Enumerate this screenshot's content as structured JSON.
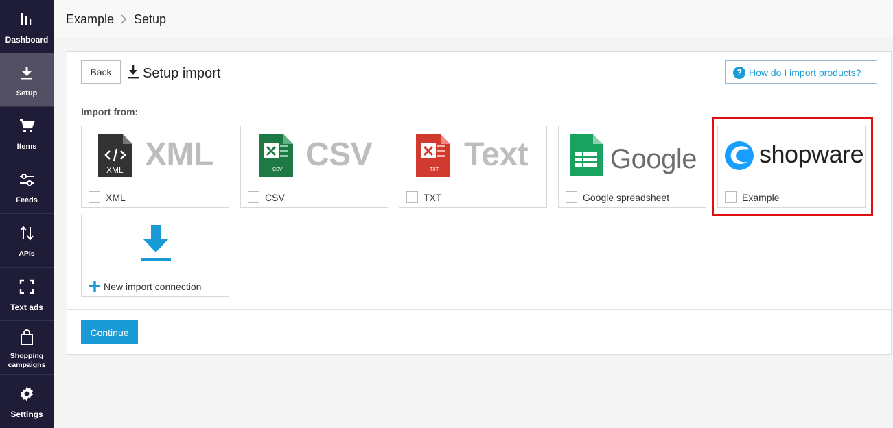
{
  "sidebar": {
    "items": [
      {
        "label": "Dashboard",
        "icon": "bar-chart-icon"
      },
      {
        "label": "Setup",
        "icon": "download-icon"
      },
      {
        "label": "Items",
        "icon": "cart-icon"
      },
      {
        "label": "Feeds",
        "icon": "sliders-icon"
      },
      {
        "label": "APIs",
        "icon": "arrows-updown-icon"
      },
      {
        "label": "Text ads",
        "icon": "frame-icon"
      },
      {
        "label": "Shopping campaigns",
        "icon": "shopping-bag-icon"
      },
      {
        "label": "Settings",
        "icon": "gear-icon"
      }
    ],
    "active_index": 1
  },
  "breadcrumb": {
    "root": "Example",
    "current": "Setup"
  },
  "panel": {
    "back_label": "Back",
    "title": "Setup import",
    "help_label": "How do I import products?",
    "import_from_label": "Import from:",
    "sources": [
      {
        "label": "XML",
        "logo_text": "XML",
        "file_badge": "XML"
      },
      {
        "label": "CSV",
        "logo_text": "CSV",
        "file_badge": "CSV"
      },
      {
        "label": "TXT",
        "logo_text": "Text",
        "file_badge": "TXT"
      },
      {
        "label": "Google spreadsheet",
        "logo_text": "Google"
      },
      {
        "label": "Example",
        "logo_text": "shopware"
      }
    ],
    "new_connection_label": "New import connection",
    "continue_label": "Continue"
  },
  "colors": {
    "sidebar_bg": "#1f1c37",
    "sidebar_active": "#535064",
    "accent": "#1a9bd7",
    "highlight": "#e01010"
  }
}
